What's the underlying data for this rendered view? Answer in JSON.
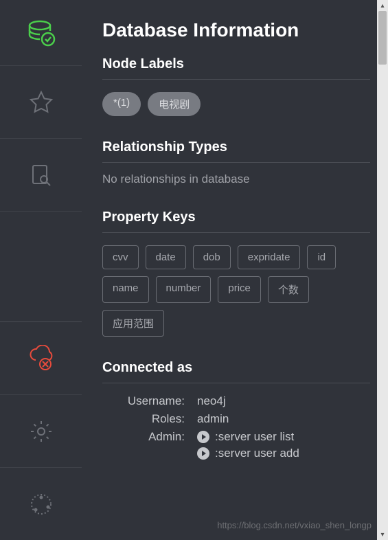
{
  "page_title": "Database Information",
  "sections": {
    "node_labels": {
      "heading": "Node Labels",
      "pills": [
        "*(1)",
        "电视剧"
      ]
    },
    "relationship_types": {
      "heading": "Relationship Types",
      "empty_message": "No relationships in database"
    },
    "property_keys": {
      "heading": "Property Keys",
      "keys": [
        "cvv",
        "date",
        "dob",
        "expridate",
        "id",
        "name",
        "number",
        "price",
        "个数",
        "应用范围"
      ]
    },
    "connected_as": {
      "heading": "Connected as",
      "username_label": "Username:",
      "username_value": "neo4j",
      "roles_label": "Roles:",
      "roles_value": "admin",
      "admin_label": "Admin:",
      "commands": [
        ":server user list",
        ":server user add"
      ]
    }
  },
  "watermark": "https://blog.csdn.net/vxiao_shen_longp"
}
